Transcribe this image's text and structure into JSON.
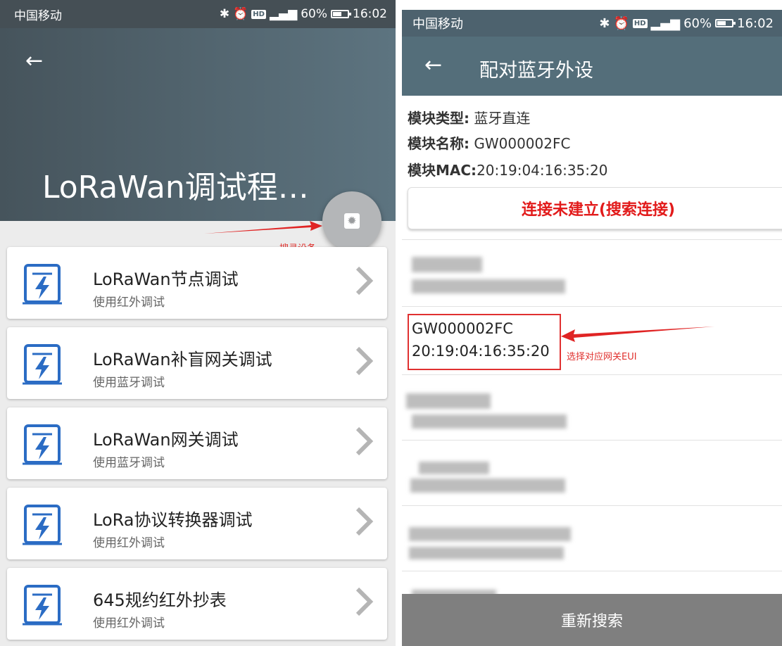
{
  "left": {
    "status": {
      "carrier": "中国移动",
      "battery": "60%",
      "time": "16:02"
    },
    "app_title": "LoRaWan调试程…",
    "annotation": "搜寻设备",
    "menu": [
      {
        "title": "LoRaWan节点调试",
        "subtitle": "使用红外调试"
      },
      {
        "title": "LoRaWan补盲网关调试",
        "subtitle": "使用蓝牙调试"
      },
      {
        "title": "LoRaWan网关调试",
        "subtitle": "使用蓝牙调试"
      },
      {
        "title": "LoRa协议转换器调试",
        "subtitle": "使用红外调试"
      },
      {
        "title": "645规约红外抄表",
        "subtitle": "使用红外调试"
      }
    ]
  },
  "right": {
    "status": {
      "carrier": "中国移动",
      "battery": "60%",
      "time": "16:02"
    },
    "title": "配对蓝牙外设",
    "module_type_label": "模块类型:",
    "module_type_value": " 蓝牙直连",
    "module_name_label": "模块名称:",
    "module_name_value": " GW000002FC",
    "module_mac_label": "模块MAC:",
    "module_mac_value": "20:19:04:16:35:20",
    "connect_button": "连接未建立(搜索连接)",
    "devices": [
      {
        "name": "GW000002FC",
        "mac": "20:19:04:16:35:20"
      }
    ],
    "annotation": "选择对应网关EUI",
    "rescan_button": "重新搜索"
  },
  "colors": {
    "header": "#546e7a",
    "accent_red": "#e03030",
    "icon_blue": "#2b6cc4"
  }
}
